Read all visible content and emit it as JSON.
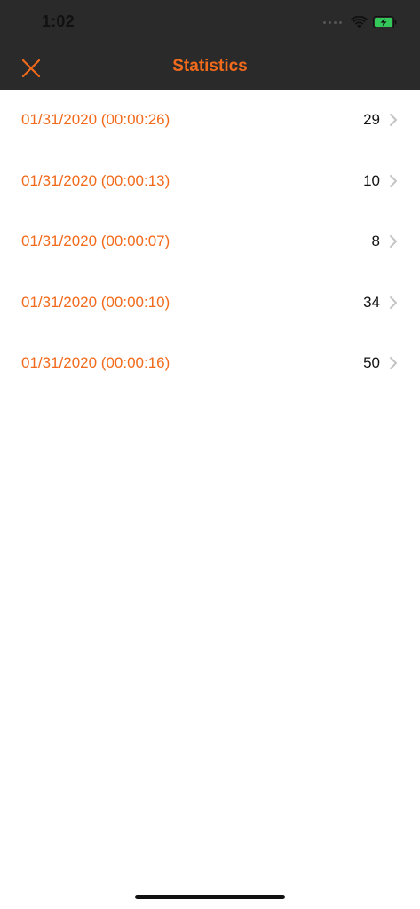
{
  "status_bar": {
    "time": "1:02"
  },
  "nav": {
    "title": "Statistics",
    "close_icon": "close-x-icon"
  },
  "colors": {
    "accent": "#f26a1b",
    "header_bg": "#2a2a2a",
    "text": "#111111",
    "chevron": "#c4c4c6",
    "battery": "#34c759"
  },
  "list": {
    "items": [
      {
        "date": "01/31/2020 (00:00:26)",
        "count": "29"
      },
      {
        "date": "01/31/2020 (00:00:13)",
        "count": "10"
      },
      {
        "date": "01/31/2020 (00:00:07)",
        "count": "8"
      },
      {
        "date": "01/31/2020 (00:00:10)",
        "count": "34"
      },
      {
        "date": "01/31/2020 (00:00:16)",
        "count": "50"
      }
    ]
  }
}
